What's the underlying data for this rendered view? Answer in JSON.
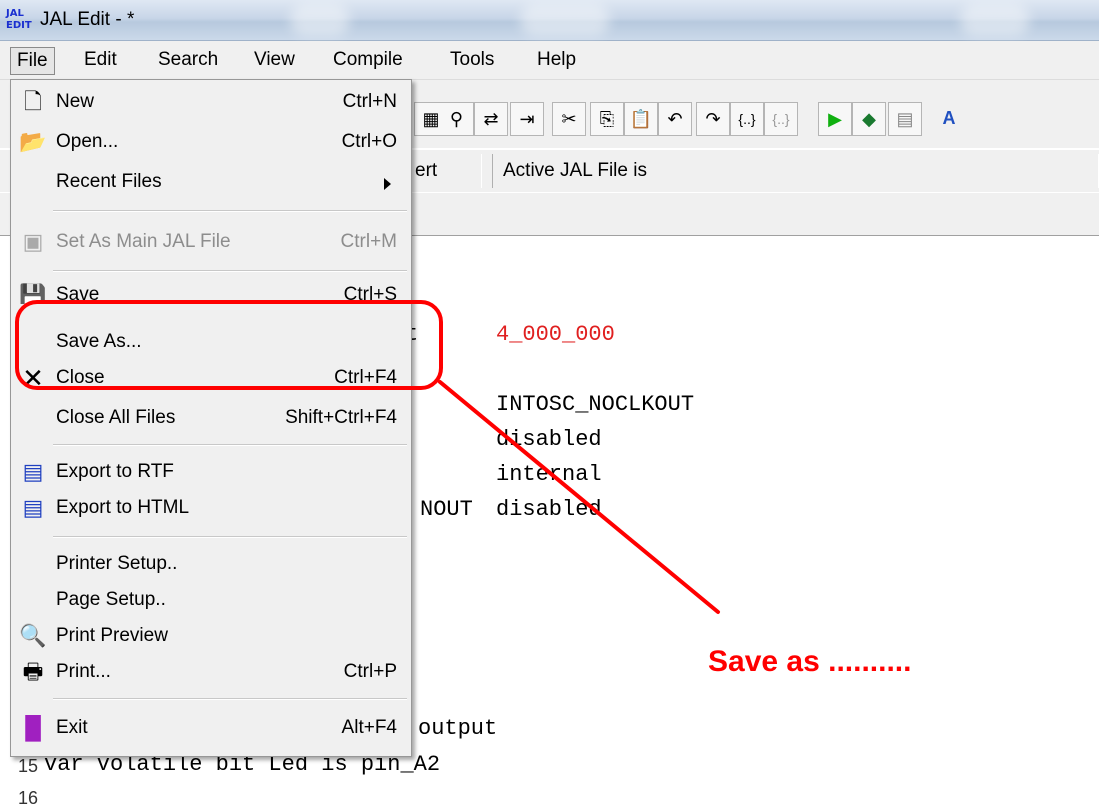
{
  "window": {
    "title": "JAL Edit - *",
    "app_icon_text_top": "JAL",
    "app_icon_text_bottom": "EDIT"
  },
  "menubar": [
    "File",
    "Edit",
    "Search",
    "View",
    "Compile",
    "Tools",
    "Help"
  ],
  "status": {
    "cell1": "ert",
    "cell2": "Active JAL File is"
  },
  "file_menu": {
    "new": {
      "label": "New",
      "shortcut": "Ctrl+N"
    },
    "open": {
      "label": "Open...",
      "shortcut": "Ctrl+O"
    },
    "recent": {
      "label": "Recent Files"
    },
    "set_main": {
      "label": "Set As Main JAL File",
      "shortcut": "Ctrl+M"
    },
    "save": {
      "label": "Save",
      "shortcut": "Ctrl+S"
    },
    "save_as": {
      "label": "Save As..."
    },
    "close": {
      "label": "Close",
      "shortcut": "Ctrl+F4"
    },
    "close_all": {
      "label": "Close All Files",
      "shortcut": "Shift+Ctrl+F4"
    },
    "export_rtf": {
      "label": "Export to RTF"
    },
    "export_html": {
      "label": "Export to HTML"
    },
    "printer_setup": {
      "label": "Printer Setup.."
    },
    "page_setup": {
      "label": "Page Setup.."
    },
    "print_preview": {
      "label": "Print Preview"
    },
    "print": {
      "label": "Print...",
      "shortcut": "Ctrl+P"
    },
    "exit": {
      "label": "Exit",
      "shortcut": "Alt+F4"
    }
  },
  "code": {
    "l1": "t",
    "l1_value": "4_000_000",
    "l2": "INTOSC_NOCLKOUT",
    "l3": "disabled",
    "l4": "internal",
    "l5_prefix": "NOUT",
    "l5": "disabled",
    "l6": "output",
    "line15_no": "15",
    "line15": "var volatile bit Led is pin_A2",
    "line16_no": "16"
  },
  "annotation": {
    "text": "Save as ..........",
    "color": "#ff0000"
  }
}
